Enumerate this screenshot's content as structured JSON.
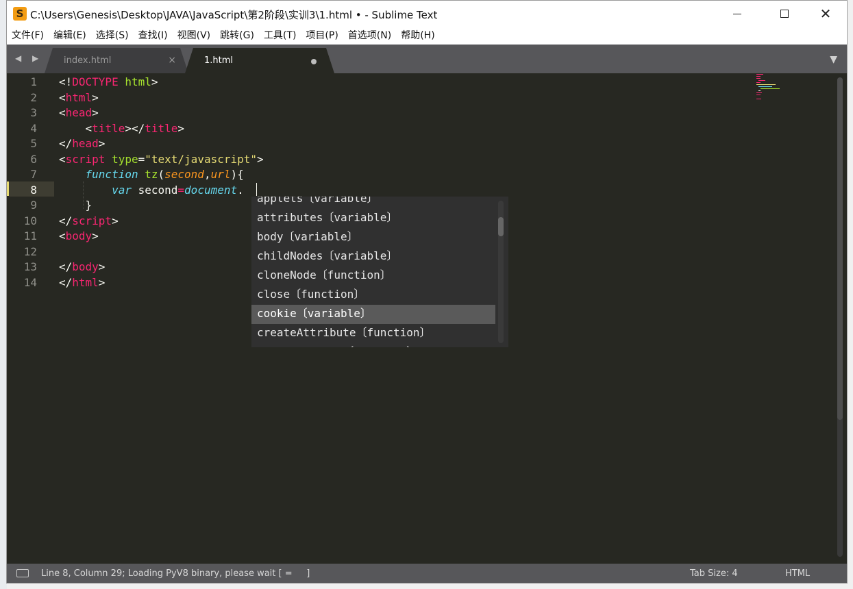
{
  "window": {
    "title": "C:\\Users\\Genesis\\Desktop\\JAVA\\JavaScript\\第2阶段\\实训3\\1.html • - Sublime Text",
    "app_icon": "S",
    "close_glyph": "✕"
  },
  "menu": [
    "文件(F)",
    "编辑(E)",
    "选择(S)",
    "查找(I)",
    "视图(V)",
    "跳转(G)",
    "工具(T)",
    "项目(P)",
    "首选项(N)",
    "帮助(H)"
  ],
  "tabs": [
    {
      "label": "index.html",
      "active": false,
      "close": "×"
    },
    {
      "label": "1.html",
      "active": true,
      "modified": true
    }
  ],
  "tabbar": {
    "nav": "◀ ▶",
    "menu": "▼"
  },
  "editor": {
    "line_numbers": [
      "1",
      "2",
      "3",
      "4",
      "5",
      "6",
      "7",
      "8",
      "9",
      "10",
      "11",
      "12",
      "13",
      "14"
    ],
    "active_line": 8,
    "lines": [
      [
        [
          "p",
          "<!"
        ],
        [
          "t",
          "DOCTYPE"
        ],
        [
          "p",
          " "
        ],
        [
          "a",
          "html"
        ],
        [
          "p",
          ">"
        ]
      ],
      [
        [
          "p",
          "<"
        ],
        [
          "t",
          "html"
        ],
        [
          "p",
          ">"
        ]
      ],
      [
        [
          "p",
          "<"
        ],
        [
          "t",
          "head"
        ],
        [
          "p",
          ">"
        ]
      ],
      [
        [
          "p",
          "    <"
        ],
        [
          "t",
          "title"
        ],
        [
          "p",
          "></"
        ],
        [
          "t",
          "title"
        ],
        [
          "p",
          ">"
        ]
      ],
      [
        [
          "p",
          "</"
        ],
        [
          "t",
          "head"
        ],
        [
          "p",
          ">"
        ]
      ],
      [
        [
          "p",
          "<"
        ],
        [
          "t",
          "script"
        ],
        [
          "p",
          " "
        ],
        [
          "a",
          "type"
        ],
        [
          "p",
          "="
        ],
        [
          "s",
          "\"text/javascript\""
        ],
        [
          "p",
          ">"
        ]
      ],
      [
        [
          "p",
          "    "
        ],
        [
          "kw",
          "function"
        ],
        [
          "p",
          " "
        ],
        [
          "f",
          "tz"
        ],
        [
          "p",
          "("
        ],
        [
          "pa",
          "second"
        ],
        [
          "p",
          ","
        ],
        [
          "pa",
          "url"
        ],
        [
          "p",
          "){"
        ]
      ],
      [
        [
          "p",
          "        "
        ],
        [
          "kw",
          "var"
        ],
        [
          "p",
          " second"
        ],
        [
          "t",
          "="
        ],
        [
          "k",
          "document"
        ],
        [
          "p",
          "."
        ]
      ],
      [
        [
          "p",
          "    }"
        ]
      ],
      [
        [
          "p",
          "</"
        ],
        [
          "t",
          "script"
        ],
        [
          "p",
          ">"
        ]
      ],
      [
        [
          "p",
          "<"
        ],
        [
          "t",
          "body"
        ],
        [
          "p",
          ">"
        ]
      ],
      [],
      [
        [
          "p",
          "</"
        ],
        [
          "t",
          "body"
        ],
        [
          "p",
          ">"
        ]
      ],
      [
        [
          "p",
          "</"
        ],
        [
          "t",
          "html"
        ],
        [
          "p",
          ">"
        ]
      ]
    ]
  },
  "autocomplete": {
    "items": [
      "applets〔variable〕",
      "attributes〔variable〕",
      "body〔variable〕",
      "childNodes〔variable〕",
      "cloneNode〔function〕",
      "close〔function〕",
      "cookie〔variable〕",
      "createAttribute〔function〕",
      "createComment〔function〕"
    ],
    "selected_index": 6
  },
  "status": {
    "message": "Line 8, Column 29; Loading PyV8 binary, please wait [ =     ]",
    "tab_size": "Tab Size: 4",
    "syntax": "HTML"
  },
  "colors": {
    "editor_bg": "#272822",
    "tag": "#f92672",
    "attribute": "#a6e22e",
    "string": "#e6db74",
    "keyword": "#66d9ef",
    "parameter": "#fd971f"
  }
}
